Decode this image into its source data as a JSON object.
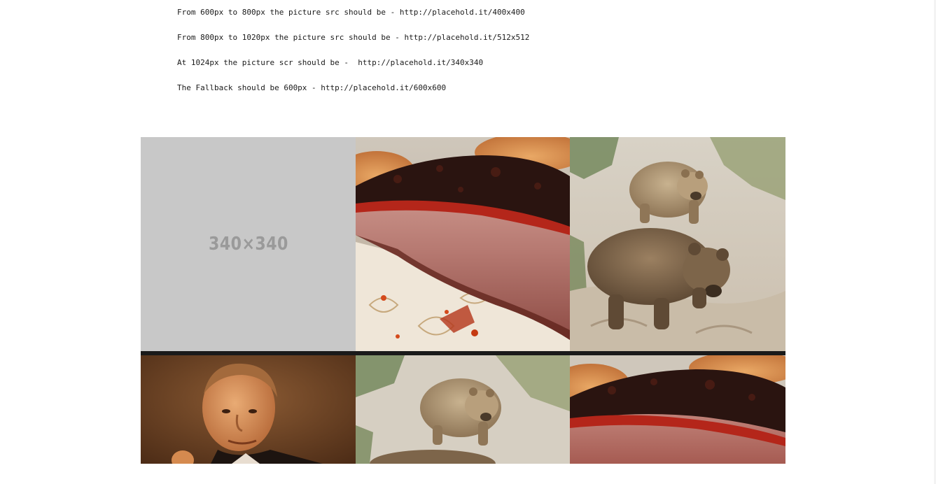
{
  "notes": [
    "From 600px to 800px the picture src should be - http://placehold.it/400x400",
    "From 800px to 1020px the picture src should be - http://placehold.it/512x512",
    "At 1024px the picture scr should be -  http://placehold.it/340x340",
    "The Fallback should be 600px - http://placehold.it/600x600"
  ],
  "gallery": {
    "placeholder_label": "340×340",
    "tiles": [
      {
        "content": "placeholder"
      },
      {
        "content": "brisket photo"
      },
      {
        "content": "bears photo"
      },
      {
        "content": "man portrait photo"
      },
      {
        "content": "bear photo"
      },
      {
        "content": "brisket photo"
      }
    ]
  },
  "colors": {
    "placeholder_bg": "#c8c8c8",
    "placeholder_text": "#9a9a9a",
    "grid_gap": "#1a1a1a"
  }
}
